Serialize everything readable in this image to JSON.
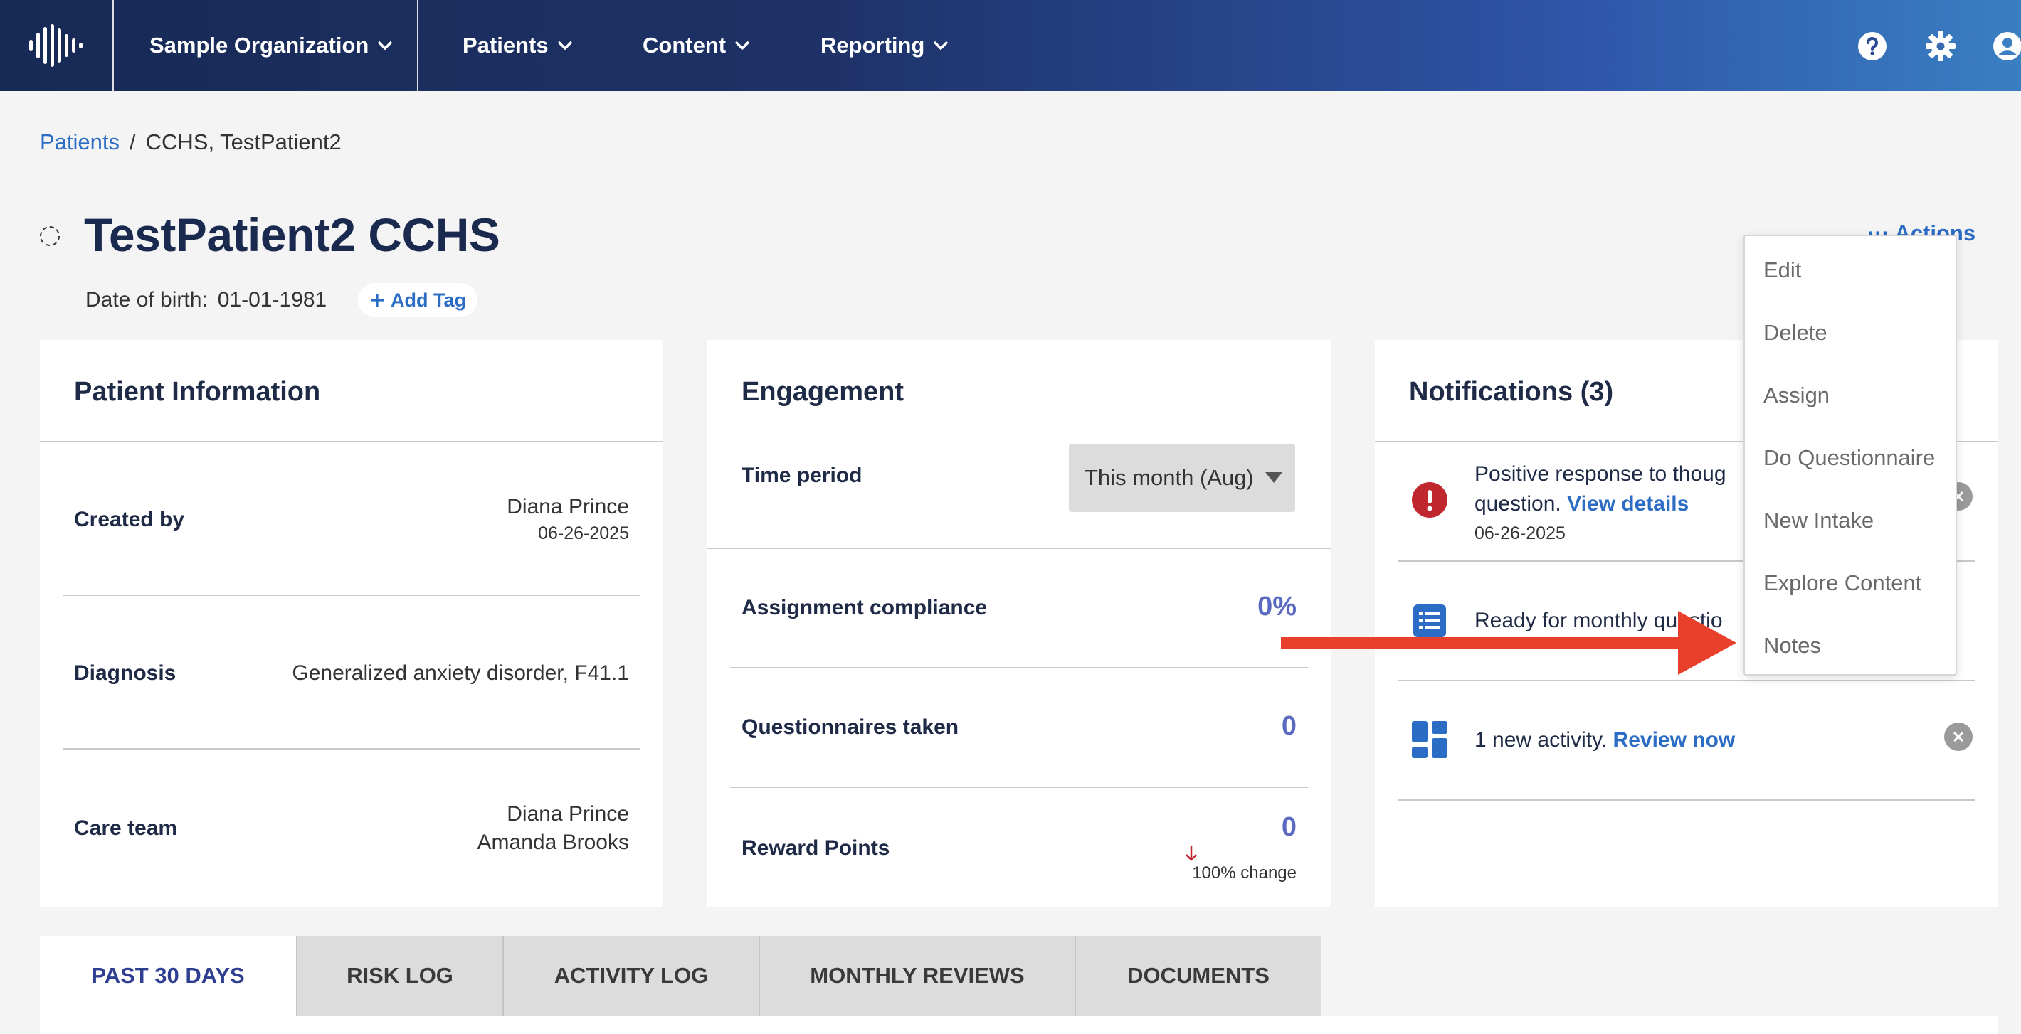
{
  "nav": {
    "org": "Sample Organization",
    "items": [
      "Patients",
      "Content",
      "Reporting"
    ]
  },
  "breadcrumb": {
    "root": "Patients",
    "separator": "/",
    "current": "CCHS, TestPatient2"
  },
  "patient": {
    "name": "TestPatient2 CCHS",
    "dob_label": "Date of birth:",
    "dob": "01-01-1981",
    "add_tag": "Add Tag",
    "actions": "··· Actions"
  },
  "patient_info": {
    "title": "Patient Information",
    "created_by_label": "Created by",
    "created_by": "Diana Prince",
    "created_date": "06-26-2025",
    "diagnosis_label": "Diagnosis",
    "diagnosis": "Generalized anxiety disorder, F41.1",
    "care_team_label": "Care team",
    "care_team": [
      "Diana Prince",
      "Amanda Brooks"
    ]
  },
  "engagement": {
    "title": "Engagement",
    "time_period_label": "Time period",
    "time_period_value": "This month (Aug)",
    "compliance_label": "Assignment compliance",
    "compliance_value": "0%",
    "questionnaires_label": "Questionnaires taken",
    "questionnaires_value": "0",
    "reward_label": "Reward Points",
    "reward_value": "0",
    "reward_change": "100% change"
  },
  "notifications": {
    "title": "Notifications (3)",
    "items": [
      {
        "text": "Positive response to thoug",
        "text2": "question.",
        "link": "View details",
        "date": "06-26-2025"
      },
      {
        "text": "Ready for monthly questio"
      },
      {
        "text": "1 new activity.",
        "link": "Review now"
      }
    ]
  },
  "tabs": [
    "PAST 30 DAYS",
    "RISK LOG",
    "ACTIVITY LOG",
    "MONTHLY REVIEWS",
    "DOCUMENTS"
  ],
  "actions_menu": [
    "Edit",
    "Delete",
    "Assign",
    "Do Questionnaire",
    "New Intake",
    "Explore Content",
    "Notes"
  ],
  "colors": {
    "accent": "#2b6cc4",
    "metric": "#5a6ac0",
    "alert": "#c0262d",
    "arrow": "#e8402a"
  }
}
